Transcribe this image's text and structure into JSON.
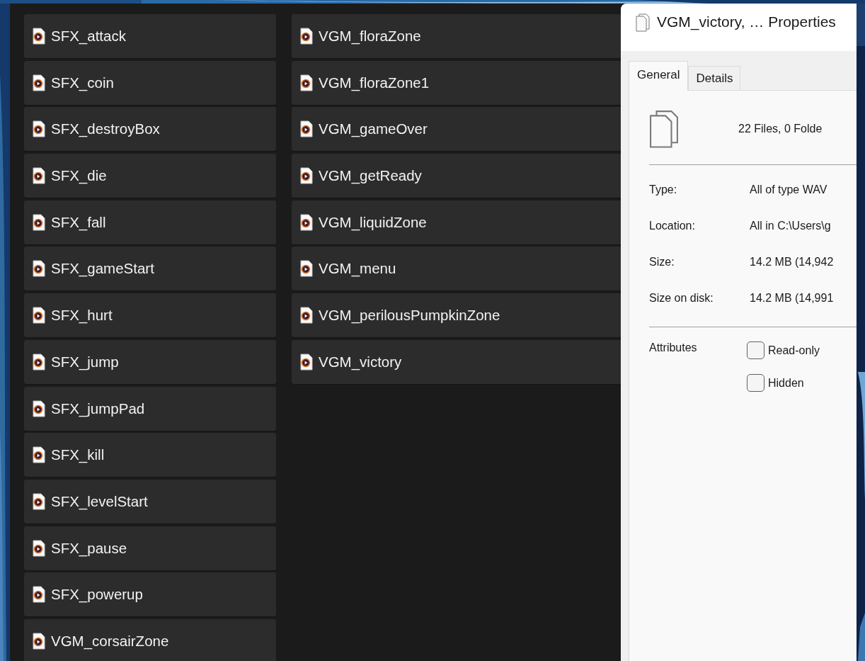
{
  "files": [
    {
      "name": "SFX_attack"
    },
    {
      "name": "SFX_coin"
    },
    {
      "name": "SFX_destroyBox"
    },
    {
      "name": "SFX_die"
    },
    {
      "name": "SFX_fall"
    },
    {
      "name": "SFX_gameStart"
    },
    {
      "name": "SFX_hurt"
    },
    {
      "name": "SFX_jump"
    },
    {
      "name": "SFX_jumpPad"
    },
    {
      "name": "SFX_kill"
    },
    {
      "name": "SFX_levelStart"
    },
    {
      "name": "SFX_pause"
    },
    {
      "name": "SFX_powerup"
    },
    {
      "name": "VGM_corsairZone"
    },
    {
      "name": "VGM_floraZone"
    },
    {
      "name": "VGM_floraZone1"
    },
    {
      "name": "VGM_gameOver"
    },
    {
      "name": "VGM_getReady"
    },
    {
      "name": "VGM_liquidZone"
    },
    {
      "name": "VGM_menu"
    },
    {
      "name": "VGM_perilousPumpkinZone"
    },
    {
      "name": "VGM_victory"
    }
  ],
  "dialog": {
    "title": "VGM_victory, … Properties",
    "tabs": [
      {
        "label": "General",
        "selected": true
      },
      {
        "label": "Details",
        "selected": false
      }
    ],
    "summary": "22 Files, 0 Folde",
    "properties": [
      {
        "label": "Type:",
        "value": "All of type WAV"
      },
      {
        "label": "Location:",
        "value": "All in C:\\Users\\g"
      },
      {
        "label": "Size:",
        "value": "14.2 MB (14,942"
      },
      {
        "label": "Size on disk:",
        "value": "14.2 MB (14,991"
      }
    ],
    "attributes": {
      "label": "Attributes",
      "options": [
        {
          "label": "Read-only",
          "checked": false
        },
        {
          "label": "Hidden",
          "checked": false
        }
      ]
    }
  }
}
